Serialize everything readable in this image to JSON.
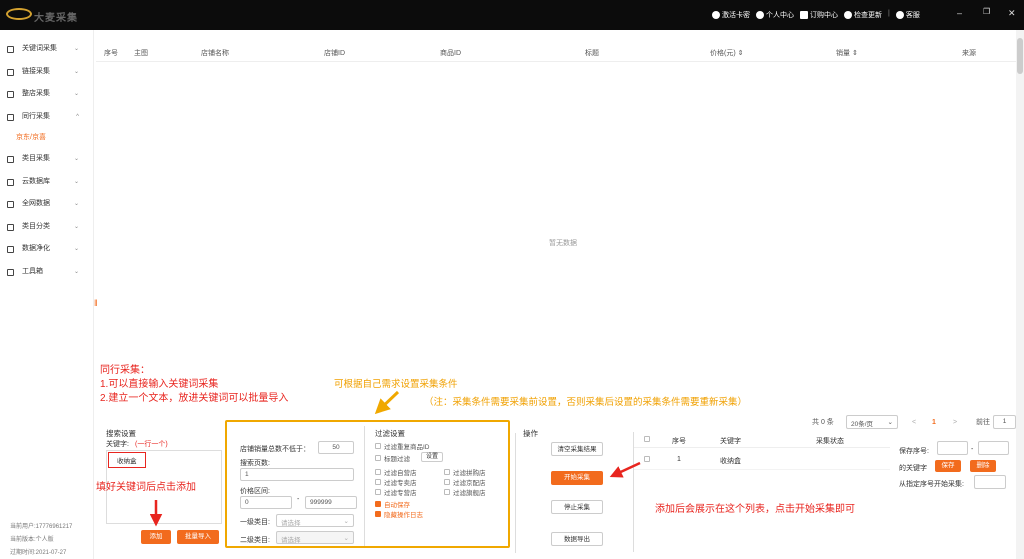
{
  "app": {
    "logo_text": "大麦采集"
  },
  "topbar": {
    "items": [
      "激活卡密",
      "个人中心",
      "订购中心",
      "检查更新",
      "客服"
    ]
  },
  "sidebar": {
    "items": [
      {
        "label": "关键词采集",
        "chev": "⌄"
      },
      {
        "label": "链接采集",
        "chev": "⌄"
      },
      {
        "label": "整店采集",
        "chev": "⌄"
      },
      {
        "label": "同行采集",
        "chev": "^"
      },
      {
        "label": "京东/京喜",
        "sub": true
      },
      {
        "label": "类目采集",
        "chev": "⌄"
      },
      {
        "label": "云数据库",
        "chev": "⌄"
      },
      {
        "label": "全网数据",
        "chev": "⌄"
      },
      {
        "label": "类目分类",
        "chev": "⌄"
      },
      {
        "label": "数据净化",
        "chev": "⌄"
      },
      {
        "label": "工具箱",
        "chev": "⌄"
      }
    ],
    "user": "当前用户:17776961217",
    "version": "当前版本:个人版",
    "expire": "过期时间:2021-07-27"
  },
  "table": {
    "headers": [
      "序号",
      "主图",
      "店铺名称",
      "店铺ID",
      "商品ID",
      "标题",
      "价格(元) ⇕",
      "销量 ⇕",
      "来源"
    ],
    "empty": "暂无数据"
  },
  "annotations": {
    "red_title": "同行采集：",
    "red_line1": "1.可以直接输入关键词采集",
    "red_line2": "2.建立一个文本，放进关键词可以批量导入",
    "orange_title": "可根据自己需求设置采集条件",
    "orange_note": "（注：采集条件需要采集前设置，否则采集后设置的采集条件需要重新采集）",
    "fill_hint": "填好关键词后点击添加",
    "list_hint": "添加后会展示在这个列表，点击开始采集即可"
  },
  "pagination": {
    "total": "共 0 条",
    "page_size": "20条/页",
    "prev": "<",
    "current": "1",
    "next": ">",
    "goto": "前往",
    "goto_value": "1",
    "page_unit": "页"
  },
  "search": {
    "title": "搜索设置",
    "keyword_label": "关键字:",
    "keyword_hint": "(一行一个)",
    "keyword_value": "收纳盒",
    "add": "添加",
    "import": "批量导入"
  },
  "params": {
    "sales_label": "店铺销量总数不低于：",
    "sales_value": "50",
    "pages_label": "搜索页数:",
    "pages_value": "1",
    "price_label": "价格区间:",
    "price_min": "0",
    "price_dash": "-",
    "price_max": "999999",
    "cat1_label": "一级类目:",
    "cat1_placeholder": "请选择",
    "cat2_label": "二级类目:",
    "cat2_placeholder": "请选择"
  },
  "filter": {
    "title": "过滤设置",
    "dedup": "过滤重复商品ID",
    "title_filter": "标题过滤",
    "setting": "设置",
    "col1": [
      "过滤自营店",
      "过滤专卖店",
      "过滤专营店"
    ],
    "col2": [
      "过滤拼购店",
      "过滤京配店",
      "过滤旗舰店"
    ],
    "auto_save": "自动保存",
    "hide_log": "隐藏操作日志"
  },
  "ops": {
    "title": "操作",
    "clear": "清空采集结果",
    "start": "开始采集",
    "stop": "停止采集",
    "export": "数据导出"
  },
  "kwtable": {
    "headers": [
      "序号",
      "关键字",
      "采集状态"
    ],
    "rows": [
      {
        "no": "1",
        "kw": "收纳盒",
        "status": ""
      }
    ]
  },
  "save": {
    "seq_label": "保存序号:",
    "dash": "-",
    "kw_label": "的关键字",
    "save": "保存",
    "delete": "删除",
    "from_label": "从指定序号开始采集:"
  },
  "colors": {
    "accent": "#f26b1d",
    "annotation_red": "#e8251f",
    "annotation_orange": "#f0a000"
  }
}
